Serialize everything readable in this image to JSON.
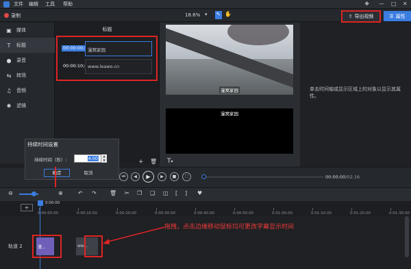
{
  "menu": {
    "items": [
      "文件",
      "编辑",
      "工具",
      "帮助"
    ]
  },
  "toolbar": {
    "record_label": "录制",
    "zoom_value": "18.6%",
    "export_label": "导出视频",
    "properties_label": "属性"
  },
  "sidebar": {
    "items": [
      {
        "label": "媒体",
        "icon": "media-icon"
      },
      {
        "label": "标题",
        "icon": "title-icon"
      },
      {
        "label": "录音",
        "icon": "microphone-icon"
      },
      {
        "label": "转场",
        "icon": "transition-icon"
      },
      {
        "label": "音频",
        "icon": "audio-icon"
      },
      {
        "label": "滤镜",
        "icon": "filter-icon"
      }
    ],
    "active_index": 1
  },
  "title_panel": {
    "heading": "标题",
    "captions": [
      {
        "time": "00:00:00;00",
        "text": "漫窝家园",
        "selected": true
      },
      {
        "time": "00:00:10;00",
        "text": "www.leawo.cn",
        "selected": false
      }
    ]
  },
  "preview": {
    "video_caption": "漫窝家园",
    "second_preview_caption": "漫窝家园",
    "text_tool_label": "T"
  },
  "properties": {
    "hint": "单击时间轴或显示区域上的对象以显示其属性。"
  },
  "duration_dialog": {
    "title": "持续时间设置",
    "label": "持续时间（秒）:",
    "value": "4.00",
    "ok_label": "确定",
    "cancel_label": "取消"
  },
  "playback": {
    "current_time": "00:00:00",
    "total_time": "02:16",
    "time_separator": "/",
    "progress": 0.0
  },
  "timeline": {
    "playhead_time": "0:00:00",
    "ruler_labels": [
      "0:00:00.00",
      "0:00:10.00",
      "0:00:20.00",
      "0:00:30.00",
      "0:00:40.00",
      "0:00:50.00",
      "0:01:00.00",
      "0:01:10.00",
      "0:01:20.00",
      "0:01:30.00"
    ],
    "track_label": "轨道 2",
    "clip1_label": "漫...",
    "clip2_label": "ww...",
    "annotation": "拖拽，点击边缘移动鼠标均可更改字幕显示时间"
  },
  "colors": {
    "accent": "#3b7de0",
    "highlight_red": "#e02424",
    "clip_purple": "#6f5fb8"
  }
}
